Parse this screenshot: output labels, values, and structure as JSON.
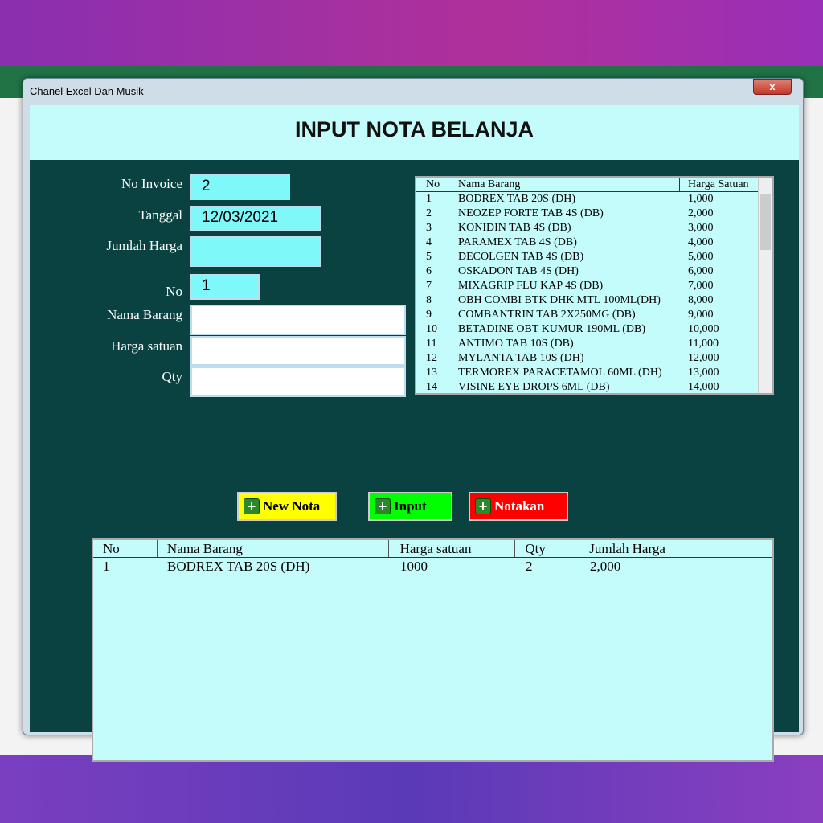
{
  "window": {
    "title": "Chanel Excel Dan Musik",
    "close": "x"
  },
  "header": {
    "title": "INPUT NOTA BELANJA"
  },
  "form": {
    "no_invoice": {
      "label": "No Invoice",
      "value": "2"
    },
    "tanggal": {
      "label": "Tanggal",
      "value": "12/03/2021"
    },
    "jumlah_harga": {
      "label": "Jumlah Harga",
      "value": ""
    },
    "no": {
      "label": "No",
      "value": "1"
    },
    "nama_barang": {
      "label": "Nama Barang",
      "value": ""
    },
    "harga_satuan": {
      "label": "Harga satuan",
      "value": ""
    },
    "qty": {
      "label": "Qty",
      "value": ""
    }
  },
  "items_list": {
    "headers": [
      "No",
      "Nama Barang",
      "Harga Satuan"
    ],
    "rows": [
      [
        "1",
        "BODREX TAB 20S (DH)",
        "1,000"
      ],
      [
        "2",
        "NEOZEP FORTE TAB 4S (DB)",
        "2,000"
      ],
      [
        "3",
        "KONIDIN TAB 4S (DB)",
        "3,000"
      ],
      [
        "4",
        "PARAMEX TAB 4S (DB)",
        "4,000"
      ],
      [
        "5",
        "DECOLGEN TAB 4S (DB)",
        "5,000"
      ],
      [
        "6",
        "OSKADON TAB 4S (DH)",
        "6,000"
      ],
      [
        "7",
        "MIXAGRIP FLU KAP 4S (DB)",
        "7,000"
      ],
      [
        "8",
        "OBH COMBI BTK DHK MTL 100ML(DH)",
        "8,000"
      ],
      [
        "9",
        "COMBANTRIN TAB 2X250MG (DB)",
        "9,000"
      ],
      [
        "10",
        "BETADINE OBT KUMUR 190ML (DB)",
        "10,000"
      ],
      [
        "11",
        "ANTIMO TAB 10S (DB)",
        "11,000"
      ],
      [
        "12",
        "MYLANTA TAB 10S (DH)",
        "12,000"
      ],
      [
        "13",
        "TERMOREX PARACETAMOL 60ML (DH)",
        "13,000"
      ],
      [
        "14",
        "VISINE EYE DROPS 6ML (DB)",
        "14,000"
      ]
    ]
  },
  "buttons": {
    "new_nota": "New Nota",
    "input": "Input",
    "notakan": "Notakan",
    "colors": {
      "new_nota": "#ffff00",
      "input": "#00ff00",
      "notakan": "#ff0000"
    }
  },
  "nota_grid": {
    "headers": [
      "No",
      "Nama Barang",
      "Harga satuan",
      "Qty",
      "Jumlah Harga"
    ],
    "rows": [
      [
        "1",
        "BODREX TAB 20S (DH)",
        "1000",
        "2",
        "2,000"
      ]
    ]
  }
}
